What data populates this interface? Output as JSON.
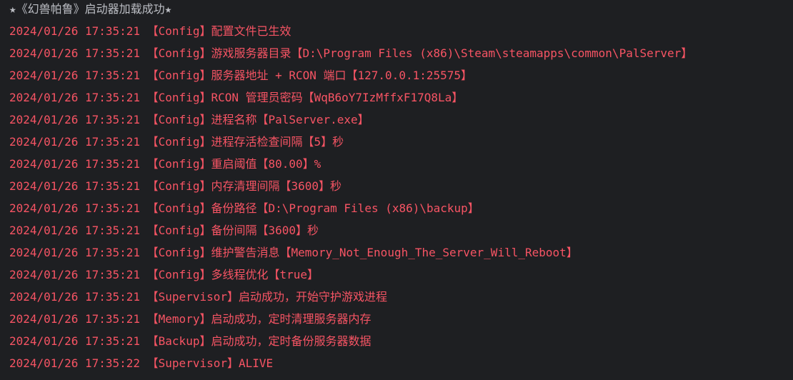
{
  "console": {
    "header": "★《幻兽帕鲁》启动器加载成功★",
    "lines": [
      "2024/01/26 17:35:21 【Config】配置文件已生效",
      "2024/01/26 17:35:21 【Config】游戏服务器目录【D:\\Program Files (x86)\\Steam\\steamapps\\common\\PalServer】",
      "2024/01/26 17:35:21 【Config】服务器地址 + RCON 端口【127.0.0.1:25575】",
      "2024/01/26 17:35:21 【Config】RCON 管理员密码【WqB6oY7IzMffxF17Q8La】",
      "2024/01/26 17:35:21 【Config】进程名称【PalServer.exe】",
      "2024/01/26 17:35:21 【Config】进程存活检查间隔【5】秒",
      "2024/01/26 17:35:21 【Config】重启阈值【80.00】%",
      "2024/01/26 17:35:21 【Config】内存清理间隔【3600】秒",
      "2024/01/26 17:35:21 【Config】备份路径【D:\\Program Files (x86)\\backup】",
      "2024/01/26 17:35:21 【Config】备份间隔【3600】秒",
      "2024/01/26 17:35:21 【Config】维护警告消息【Memory_Not_Enough_The_Server_Will_Reboot】",
      "2024/01/26 17:35:21 【Config】多线程优化【true】",
      "2024/01/26 17:35:21 【Supervisor】启动成功，开始守护游戏进程",
      "2024/01/26 17:35:21 【Memory】启动成功，定时清理服务器内存",
      "2024/01/26 17:35:21 【Backup】启动成功，定时备份服务器数据",
      "2024/01/26 17:35:22 【Supervisor】ALIVE"
    ]
  },
  "colors": {
    "background": "#1e1f22",
    "header_text": "#bcbec4",
    "log_text": "#f75464"
  }
}
